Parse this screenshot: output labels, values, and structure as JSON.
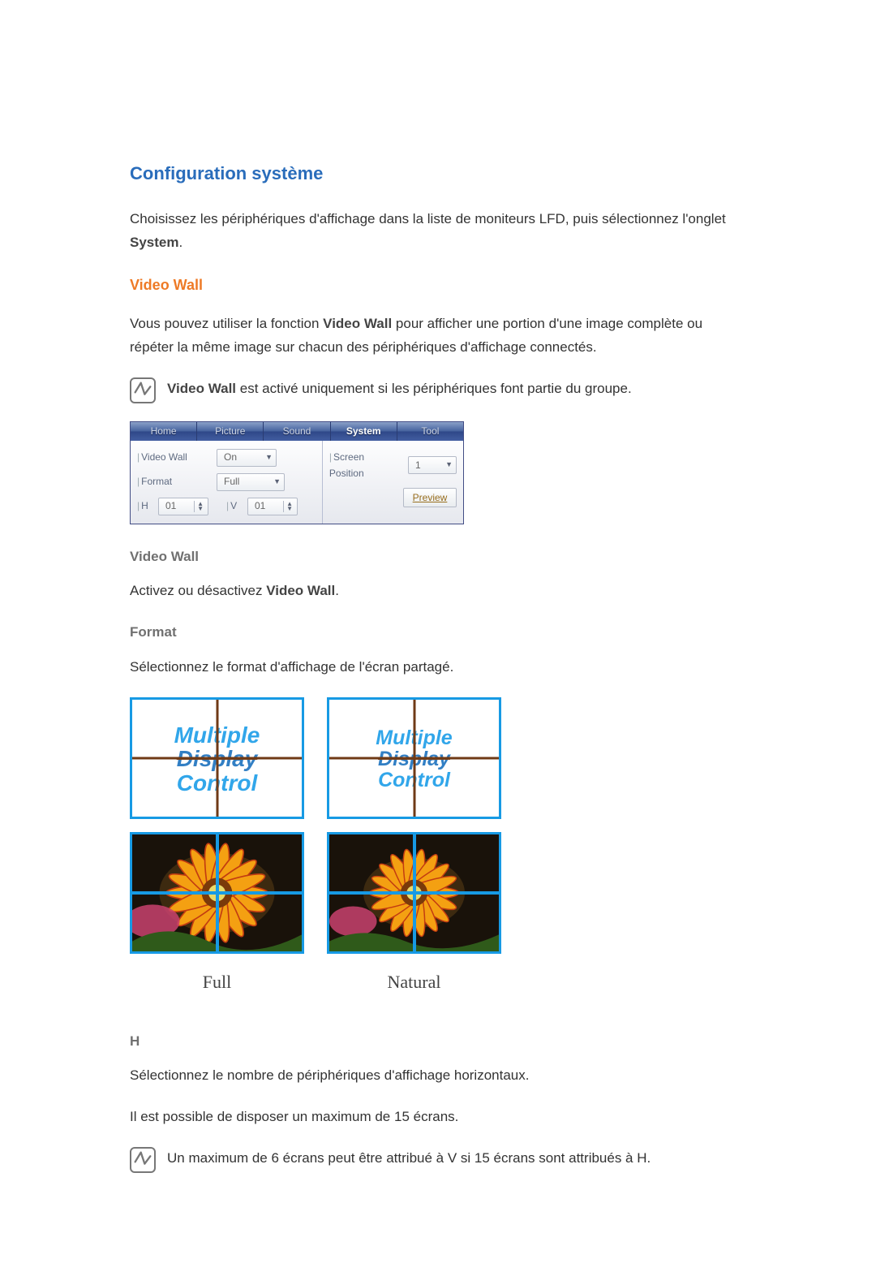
{
  "headings": {
    "section": "Configuration système",
    "sub": "Video Wall",
    "videoWall2": "Video Wall",
    "format": "Format",
    "h": "H"
  },
  "paragraphs": {
    "intro_a": "Choisissez les périphériques d'affichage dans la liste de moniteurs LFD, puis sélectionnez l'onglet ",
    "intro_b": "System",
    "intro_c": ".",
    "vw_a": "Vous pouvez utiliser la fonction ",
    "vw_b": "Video Wall",
    "vw_c": " pour afficher une portion d'une image complète ou répéter la même image sur chacun des périphériques d'affichage connectés.",
    "note1_a": "Video Wall",
    "note1_b": " est activé uniquement si les périphériques font partie du groupe.",
    "act_a": "Activez ou désactivez ",
    "act_b": "Video Wall",
    "act_c": ".",
    "formatDesc": "Sélectionnez le format d'affichage de l'écran partagé.",
    "hDesc": "Sélectionnez le nombre de périphériques d'affichage horizontaux.",
    "hMax": "Il est possible de disposer un maximum de 15 écrans.",
    "note2": "Un maximum de 6 écrans peut être attribué à V si 15 écrans sont attribués à H."
  },
  "panel": {
    "tabs": [
      "Home",
      "Picture",
      "Sound",
      "System",
      "Tool"
    ],
    "activeTab": 3,
    "labels": {
      "videoWall": "Video Wall",
      "screenPos": "Screen Position",
      "format": "Format",
      "h": "H",
      "v": "V"
    },
    "values": {
      "videoWall": "On",
      "screenPos": "1",
      "format": "Full",
      "h": "01",
      "v": "01"
    },
    "preview": "Preview"
  },
  "mdc": {
    "l1": "Multiple",
    "l2": "Display",
    "l3": "Control"
  },
  "captions": {
    "full": "Full",
    "natural": "Natural"
  }
}
